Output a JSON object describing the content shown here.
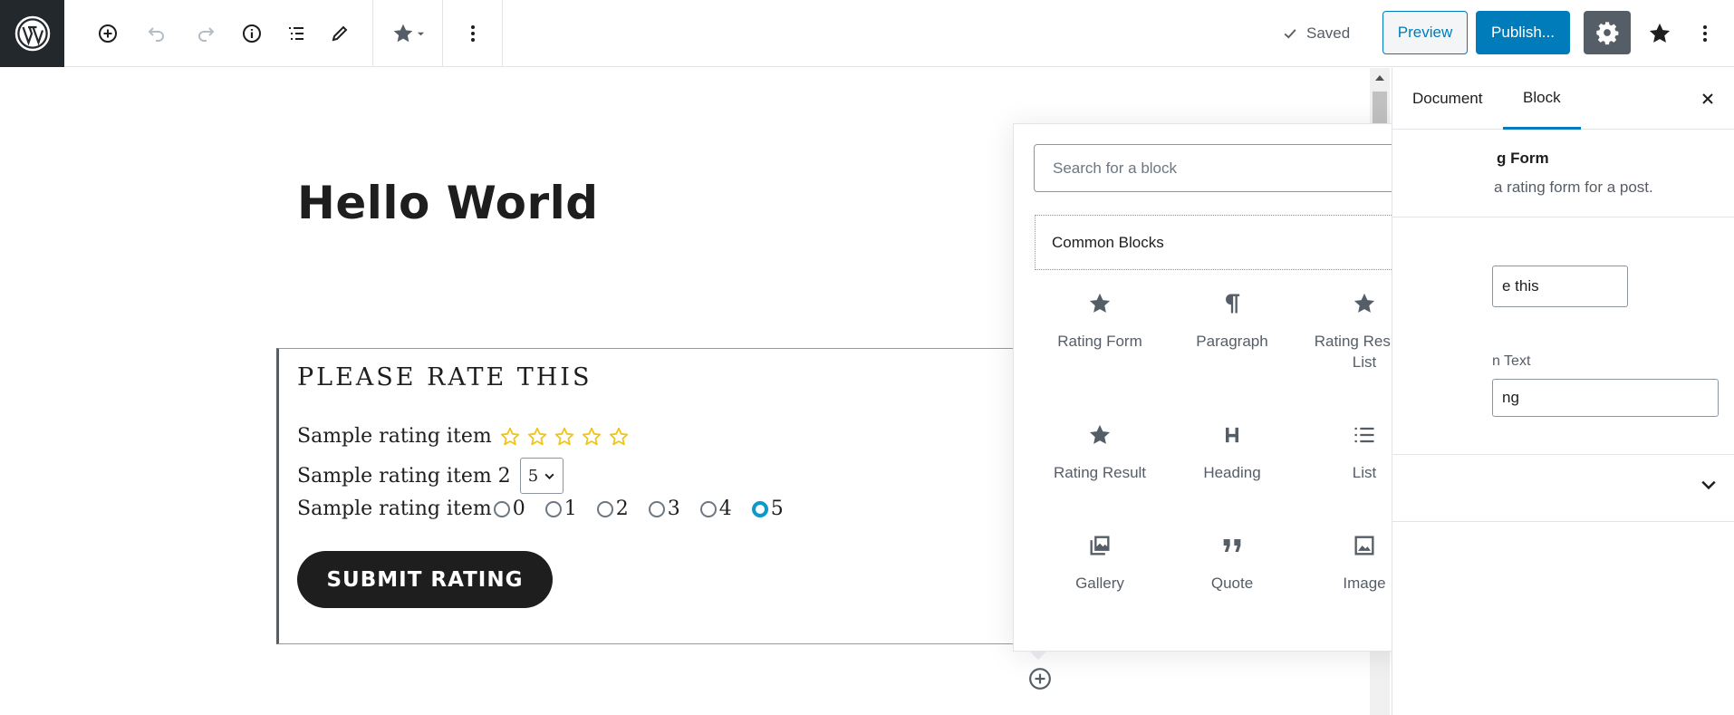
{
  "toolbar": {
    "saved_label": "Saved",
    "preview_label": "Preview",
    "publish_label": "Publish..."
  },
  "post": {
    "title": "Hello World"
  },
  "rating_form": {
    "heading": "PLEASE RATE THIS",
    "item1_label": "Sample rating item",
    "item1_stars": 5,
    "item2_label": "Sample rating item 2",
    "item2_select_value": "5",
    "item3_label": "Sample rating item",
    "item3_options": [
      "0",
      "1",
      "2",
      "3",
      "4",
      "5"
    ],
    "item3_selected": "5",
    "submit_label": "SUBMIT RATING",
    "star_color": "#f0c419"
  },
  "inserter": {
    "search_placeholder": "Search for a block",
    "category": "Common Blocks",
    "blocks": [
      {
        "label": "Rating Form",
        "icon": "star-icon"
      },
      {
        "label": "Paragraph",
        "icon": "paragraph-icon"
      },
      {
        "label": "Rating Results List",
        "icon": "star-icon"
      },
      {
        "label": "Rating Result",
        "icon": "star-icon"
      },
      {
        "label": "Heading",
        "icon": "heading-icon"
      },
      {
        "label": "List",
        "icon": "list-icon"
      },
      {
        "label": "Gallery",
        "icon": "gallery-icon"
      },
      {
        "label": "Quote",
        "icon": "quote-icon"
      },
      {
        "label": "Image",
        "icon": "image-icon"
      }
    ]
  },
  "sidebar": {
    "tabs": [
      "Document",
      "Block"
    ],
    "active_tab": "Block",
    "block_title": "g Form",
    "block_description": "a rating form for a post.",
    "field1_value": "e this",
    "field2_label": "n Text",
    "field2_value": "ng"
  },
  "colors": {
    "accent": "#007cba",
    "wp_dark": "#23282d",
    "radio_checked": "#0e9ac9"
  }
}
